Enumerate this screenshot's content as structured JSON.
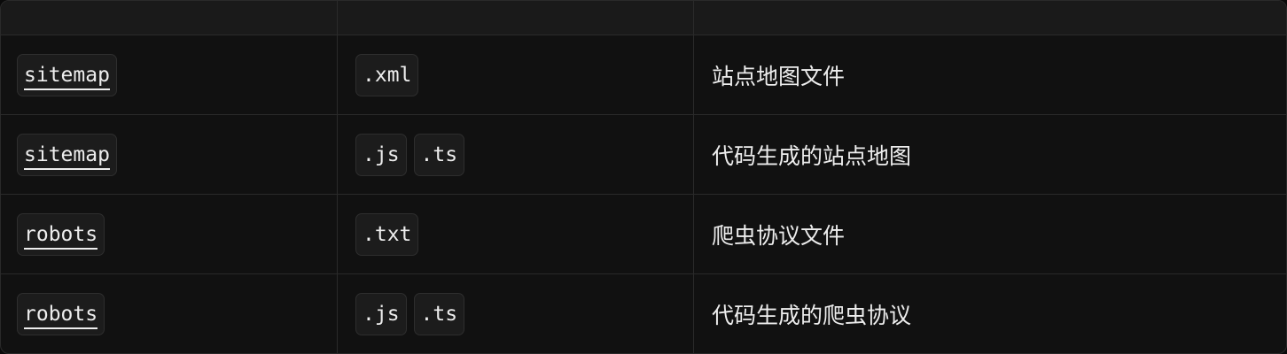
{
  "header": {
    "col1": "",
    "col2": "",
    "col3": ""
  },
  "rows": [
    {
      "file": "sitemap",
      "extensions": [
        ".xml"
      ],
      "description": "站点地图文件"
    },
    {
      "file": "sitemap",
      "extensions": [
        ".js",
        ".ts"
      ],
      "description": "代码生成的站点地图"
    },
    {
      "file": "robots",
      "extensions": [
        ".txt"
      ],
      "description": "爬虫协议文件"
    },
    {
      "file": "robots",
      "extensions": [
        ".js",
        ".ts"
      ],
      "description": "代码生成的爬虫协议"
    }
  ],
  "colors": {
    "background": "#111111",
    "header": "#1a1a1a",
    "border": "#2a2a2a",
    "text": "#ededed"
  }
}
